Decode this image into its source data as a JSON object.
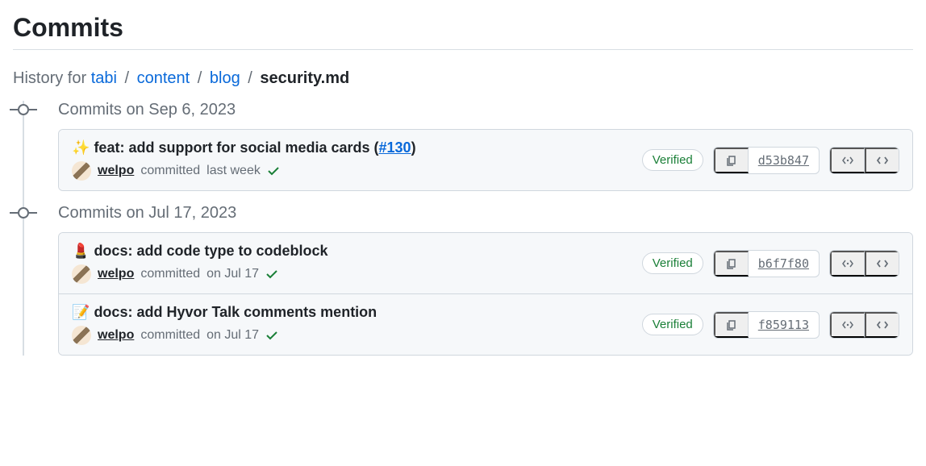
{
  "page_title": "Commits",
  "breadcrumb": {
    "prefix": "History for",
    "parts": [
      "tabi",
      "content",
      "blog"
    ],
    "current": "security.md"
  },
  "groups": [
    {
      "date_label": "Commits on Sep 6, 2023",
      "commits": [
        {
          "emoji": "✨",
          "title": "feat: add support for social media cards (",
          "pr": "#130",
          "title_suffix": ")",
          "author": "welpo",
          "meta_action": "committed",
          "meta_time": "last week",
          "verified": "Verified",
          "hash": "d53b847"
        }
      ]
    },
    {
      "date_label": "Commits on Jul 17, 2023",
      "commits": [
        {
          "emoji": "💄",
          "title": "docs: add code type to codeblock",
          "pr": "",
          "title_suffix": "",
          "author": "welpo",
          "meta_action": "committed",
          "meta_time": "on Jul 17",
          "verified": "Verified",
          "hash": "b6f7f80"
        },
        {
          "emoji": "📝",
          "title": "docs: add Hyvor Talk comments mention",
          "pr": "",
          "title_suffix": "",
          "author": "welpo",
          "meta_action": "committed",
          "meta_time": "on Jul 17",
          "verified": "Verified",
          "hash": "f859113"
        }
      ]
    }
  ]
}
